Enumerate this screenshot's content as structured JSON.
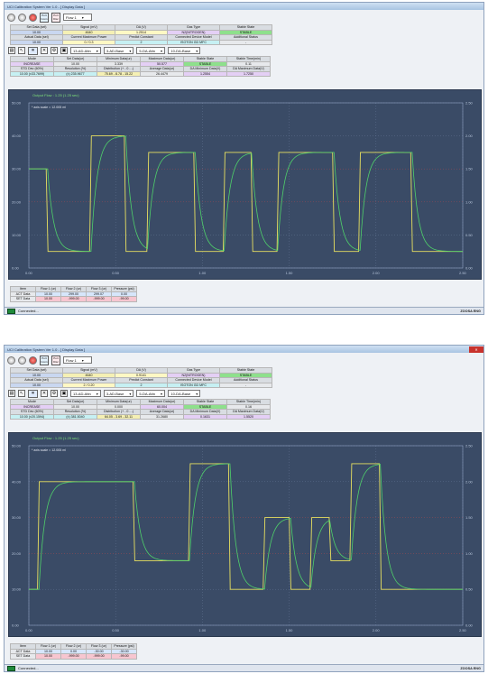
{
  "windows": [
    {
      "title": "UCI Calibration System Ver 1.0  - [ Display Data ]",
      "flow_select": "Flow 1",
      "toolbar_small": [
        "Port Conn",
        "Port Disc"
      ],
      "info_rows": [
        [
          "Set Data (sel)",
          "Signal (mV)",
          "DA (V)",
          "Gas Type",
          "Stable State"
        ],
        [
          "10.00",
          "4640",
          "1.2514",
          "N2(NITROGEN)",
          "STABLE"
        ],
        [
          "Actual Data (sel)",
          "Current Maximum Power",
          "Predict Constant",
          "Connected Device Model",
          "Additional Status"
        ],
        [
          "10.00",
          "0 / 0.3",
          "2",
          "ISOTON GD MFC",
          "-"
        ]
      ],
      "tool_selects": [
        "13-AD-Attn",
        "3-AD-Base",
        "5-DA-Attn",
        "10-DA-Base"
      ],
      "stat_rows": [
        [
          "Mode",
          "Set Data(ur)",
          "Minimum Data(ur)",
          "Maximum Data(ur)",
          "Stable State",
          "Stable Time(min)"
        ],
        [
          "INCREASE",
          "10.00",
          "3.339",
          "50.577",
          "STABLE",
          "0.11"
        ],
        [
          "STD Dev (60%)",
          "Resolution (%)",
          "Distribution (+ - 0 - -)",
          "Average Data(ur)",
          "DA Minimum Data(V)",
          "DA Maximum Data(V)"
        ],
        [
          "10.00 (±33.7699)",
          "(±) 235.9677",
          "75.69 - 8.78 - 15.22",
          "26.4479",
          "1.2554",
          "1.7250"
        ]
      ],
      "chart": {
        "legend": "Output Flow : 1.25 (1.25 sec)",
        "subtitle": "* axis scale = 12.005 ml",
        "y_left": [
          "50.00",
          "40.00",
          "30.00",
          "20.00",
          "10.00",
          "0.00"
        ],
        "y_right": [
          "2.50",
          "2.00",
          "1.50",
          "1.00",
          "0.50",
          "0.00"
        ],
        "x_ticks": [
          "0.00",
          "0.50",
          "1.00",
          "1.50",
          "2.00",
          "2.50"
        ]
      },
      "bottom_table": [
        [
          "Item",
          "Flow 1 (ur)",
          "Flow 2 (ur)",
          "Flow 3 (ur)",
          "Pressure (psi)"
        ],
        [
          "ACT Data",
          "10.00",
          "299.00",
          "299.07",
          "0.00"
        ],
        [
          "SET Data",
          "10.00",
          "-999.00",
          "-999.00",
          "-99.00"
        ]
      ],
      "status": "Connected...",
      "logo": "ZOOSA ENG"
    },
    {
      "title": "UCI Calibration System Ver 1.0  - [ Display Data ]",
      "flow_select": "Flow 1",
      "toolbar_small": [
        "Port Conn",
        "Port Disc"
      ],
      "info_rows": [
        [
          "Set Data (sel)",
          "Signal (mV)",
          "DA (V)",
          "Gas Type",
          "Stable State"
        ],
        [
          "10.00",
          "4640",
          "0.9141",
          "N2(NITROGEN)",
          "STABLE"
        ],
        [
          "Actual Data (sel)",
          "Current Maximum Power",
          "Predict Constant",
          "Connected Device Model",
          "Additional Status"
        ],
        [
          "10.00",
          "2 / 0.20",
          "2",
          "ISOTON GD MFC",
          "-"
        ]
      ],
      "tool_selects": [
        "13-AD-Attn",
        "3-AD-Base",
        "5-DA-Attn",
        "10-DA-Base"
      ],
      "stat_rows": [
        [
          "Mode",
          "Set Data(ur)",
          "Minimum Data(ur)",
          "Maximum Data(ur)",
          "Stable State",
          "Stable Time(min)"
        ],
        [
          "INCREASE",
          "10.00",
          "0.000",
          "60.004",
          "STABLE",
          "0.16"
        ],
        [
          "STD Dev (60%)",
          "Resolution (%)",
          "Distribution (+ - 0 - -)",
          "Average Data(ur)",
          "DA Minimum Data(V)",
          "DA Maximum Data(V)"
        ],
        [
          "10.00 (±20.1594)",
          "(±) 381.5040",
          "64.05 - 3.69 - 32.11",
          "31.2680",
          "0.1631",
          "1.5520"
        ]
      ],
      "chart": {
        "legend": "Output Flow : 1.25 (1.25 sec)",
        "subtitle": "* axis scale = 12.005 ml",
        "y_left": [
          "50.00",
          "40.00",
          "30.00",
          "20.00",
          "10.00",
          "0.00"
        ],
        "y_right": [
          "2.50",
          "2.00",
          "1.50",
          "1.00",
          "0.50",
          "0.00"
        ],
        "x_ticks": [
          "0.00",
          "0.50",
          "1.00",
          "1.50",
          "2.00",
          "2.50"
        ]
      },
      "bottom_table": [
        [
          "Item",
          "Flow 1 (ur)",
          "Flow 2 (ur)",
          "Flow 3 (ur)",
          "Pressure (psi)"
        ],
        [
          "ACT Data",
          "10.00",
          "0.00",
          "-30.00",
          "-30.00"
        ],
        [
          "SET Data",
          "10.00",
          "-999.00",
          "-999.00",
          "-99.00"
        ]
      ],
      "status": "Connected...",
      "logo": "ZOOSA ENG"
    }
  ],
  "chart_data": [
    {
      "type": "line",
      "x": [
        0,
        0.1,
        0.11,
        0.35,
        0.36,
        0.55,
        0.56,
        0.68,
        0.69,
        0.95,
        0.96,
        1.12,
        1.13,
        1.28,
        1.29,
        1.43,
        1.44,
        1.75,
        1.76,
        1.9,
        1.91,
        2.2,
        2.21,
        2.5
      ],
      "series": [
        {
          "values": [
            30,
            30,
            5,
            5,
            40,
            40,
            5,
            5,
            35,
            35,
            5,
            5,
            35,
            35,
            5,
            5,
            35,
            35,
            5,
            5,
            35,
            35,
            5,
            5
          ]
        }
      ],
      "xlim": [
        0,
        2.5
      ],
      "ylim": [
        0,
        50
      ]
    },
    {
      "type": "line",
      "x": [
        0,
        0.05,
        0.06,
        0.6,
        0.61,
        0.92,
        0.93,
        1.15,
        1.16,
        1.35,
        1.36,
        1.5,
        1.51,
        1.62,
        1.63,
        1.73,
        1.74,
        1.85,
        1.86,
        2.02,
        2.03,
        2.5
      ],
      "series": [
        {
          "values": [
            10,
            10,
            40,
            40,
            18,
            18,
            45,
            45,
            10,
            10,
            30,
            30,
            10,
            10,
            30,
            30,
            18,
            18,
            45,
            45,
            10,
            10
          ]
        }
      ],
      "xlim": [
        0,
        2.5
      ],
      "ylim": [
        0,
        50
      ]
    }
  ]
}
